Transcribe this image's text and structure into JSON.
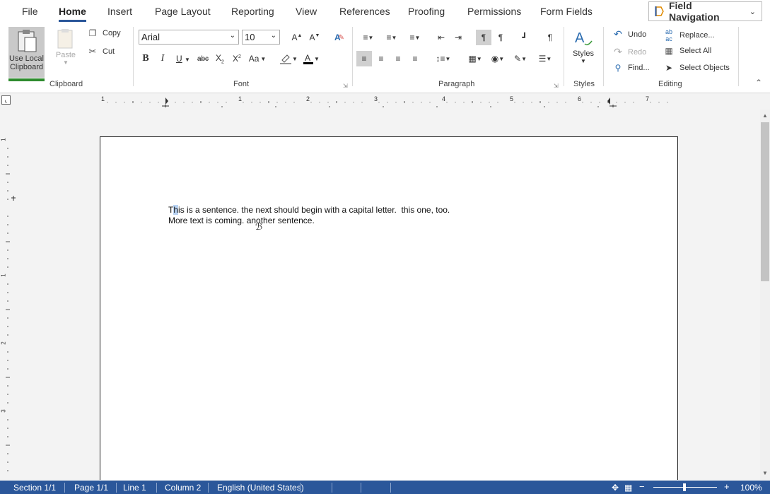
{
  "menu": {
    "tabs": [
      "File",
      "Home",
      "Insert",
      "Page Layout",
      "Reporting",
      "View",
      "References",
      "Proofing",
      "Permissions",
      "Form Fields"
    ],
    "active": "Home",
    "field_navigation": "Field Navigation"
  },
  "clipboard": {
    "use_local_line1": "Use Local",
    "use_local_line2": "Clipboard",
    "paste": "Paste",
    "copy": "Copy",
    "cut": "Cut",
    "label": "Clipboard"
  },
  "font": {
    "name": "Arial",
    "size": "10",
    "change_case": "Aa",
    "label": "Font"
  },
  "paragraph": {
    "label": "Paragraph"
  },
  "styles": {
    "button": "Styles",
    "label": "Styles"
  },
  "editing": {
    "undo": "Undo",
    "redo": "Redo",
    "find": "Find...",
    "replace": "Replace...",
    "select_all": "Select All",
    "select_objects": "Select Objects",
    "label": "Editing"
  },
  "ruler": {
    "numbers": [
      "1",
      "1",
      "2",
      "3",
      "4",
      "5",
      "6",
      "7"
    ]
  },
  "vruler": {
    "numbers": [
      "1",
      "1",
      "2",
      "3"
    ]
  },
  "document": {
    "line1_first": "T",
    "line1_selected": "h",
    "line1_rest": "is is a sentence. the next should begin with a capital letter.  this one, too.",
    "line2": "More text is coming. another sentence."
  },
  "status": {
    "section": "Section 1/1",
    "page": "Page 1/1",
    "line": "Line 1",
    "column": "Column 2",
    "language": "English (United States)",
    "zoom": "100%"
  },
  "colors": {
    "accent": "#2b579a",
    "status_bg": "#2b579a",
    "selection": "#b9d3f3"
  }
}
